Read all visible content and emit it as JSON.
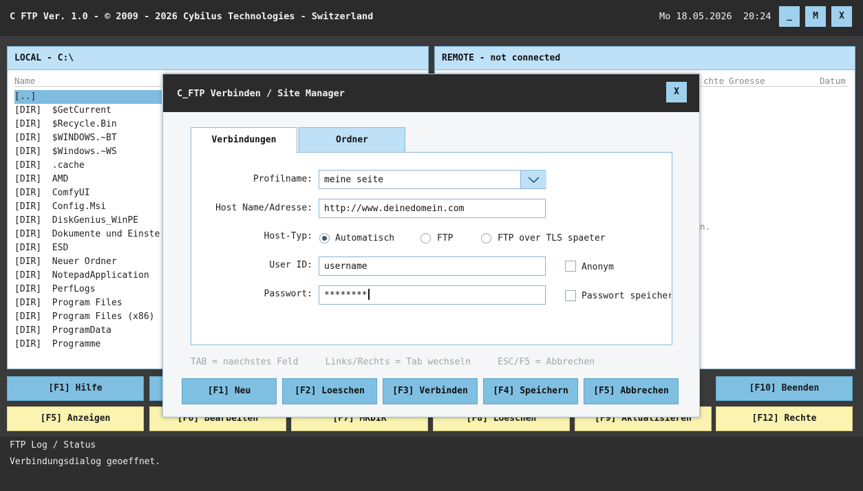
{
  "titlebar": {
    "title": "C FTP Ver. 1.0 - © 2009 - 2026 Cybilus Technologies - Switzerland",
    "datetime": "Mo 18.05.2026  20:24",
    "min": "_",
    "max": "M",
    "close": "X"
  },
  "local": {
    "header": "LOCAL - C:\\",
    "col_name": "Name",
    "items": [
      "[..]",
      "[DIR]  $GetCurrent",
      "[DIR]  $Recycle.Bin",
      "[DIR]  $WINDOWS.~BT",
      "[DIR]  $Windows.~WS",
      "[DIR]  .cache",
      "[DIR]  AMD",
      "[DIR]  ComfyUI",
      "[DIR]  Config.Msi",
      "[DIR]  DiskGenius_WinPE",
      "[DIR]  Dokumente und Einste",
      "[DIR]  ESD",
      "[DIR]  Neuer Ordner",
      "[DIR]  NotepadApplication",
      "[DIR]  PerfLogs",
      "[DIR]  Program Files",
      "[DIR]  Program Files (x86)",
      "[DIR]  ProgramData",
      "[DIR]  Programme"
    ]
  },
  "remote": {
    "header": "REMOTE - not connected",
    "col_rechte": "chte",
    "col_groesse": "Groesse",
    "col_datum": "Datum",
    "fragment": "n."
  },
  "fkeys_row1": [
    "[F1] Hilfe",
    "[F10] Beenden"
  ],
  "fkeys_row2": [
    "[F5] Anzeigen",
    "[F6] Bearbeiten",
    "[F7] MKDIR",
    "[F8] Loeschen",
    "[F9] Aktualisieren",
    "[F12] Rechte"
  ],
  "log": {
    "title": "FTP Log / Status",
    "text": "Verbindungsdialog geoeffnet."
  },
  "dialog": {
    "title": "C_FTP Verbinden / Site Manager",
    "close": "X",
    "tabs": [
      "Verbindungen",
      "Ordner"
    ],
    "labels": {
      "profil": "Profilname:",
      "host": "Host Name/Adresse:",
      "hosttyp": "Host-Typ:",
      "user": "User ID:",
      "pass": "Passwort:"
    },
    "values": {
      "profil": "meine seite",
      "host": "http://www.deinedomein.com",
      "user": "username",
      "pass": "********"
    },
    "radios": [
      "Automatisch",
      "FTP",
      "FTP over TLS spaeter"
    ],
    "checks": [
      "Anonym",
      "Passwort speicher"
    ],
    "hint": "TAB = naechstes Feld     Links/Rechts = Tab wechseln     ESC/F5 = Abbrechen",
    "buttons": [
      "[F1] Neu",
      "[F2] Loeschen",
      "[F3] Verbinden",
      "[F4] Speichern",
      "[F5] Abbrechen"
    ]
  },
  "colors": {
    "accent": "#7fc0e2",
    "header": "#bfe1f7",
    "yellow": "#fbf3b0",
    "dark": "#2b2b2b"
  }
}
